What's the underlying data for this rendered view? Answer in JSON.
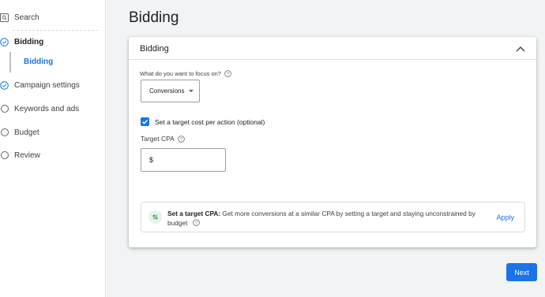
{
  "sidebar": {
    "items": [
      {
        "label": "Search",
        "icon": "search-icon"
      },
      {
        "label": "Bidding",
        "icon": "check-circle-icon"
      },
      {
        "label": "Bidding"
      },
      {
        "label": "Campaign settings",
        "icon": "check-circle-icon"
      },
      {
        "label": "Keywords and ads",
        "icon": "circle-icon"
      },
      {
        "label": "Budget",
        "icon": "circle-icon"
      },
      {
        "label": "Review",
        "icon": "circle-icon"
      }
    ]
  },
  "main": {
    "page_title": "Bidding",
    "card": {
      "title": "Bidding",
      "focus_question": "What do you want to focus on?",
      "focus_value": "Conversions",
      "target_checkbox_label": "Set a target cost per action (optional)",
      "target_checked": true,
      "target_cpa_label": "Target CPA",
      "target_cpa_value": "$"
    },
    "recommendation": {
      "title": "Set a target CPA:",
      "body": "Get more conversions at a similar CPA by setting a target and staying unconstrained by budget",
      "apply_label": "Apply"
    },
    "next_label": "Next"
  },
  "colors": {
    "accent": "#1a73e8",
    "background": "#f1f3f4",
    "success_green": "#1e8e3e"
  }
}
